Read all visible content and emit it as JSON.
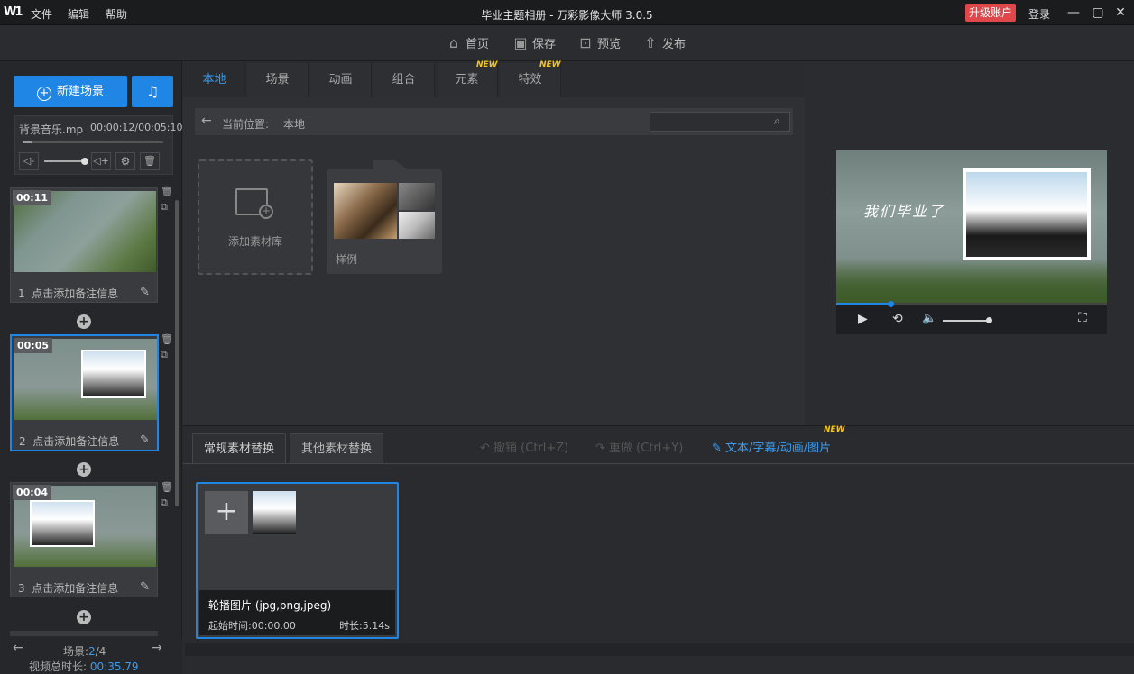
{
  "app": {
    "title": "毕业主题相册 - 万彩影像大师 3.0.5",
    "logo": "W1",
    "menu": [
      "文件",
      "编辑",
      "帮助"
    ],
    "upgrade": "升级账户",
    "login": "登录"
  },
  "toolbar": {
    "home": "首页",
    "save": "保存",
    "preview": "预览",
    "publish": "发布"
  },
  "left": {
    "new_scene": "新建场景",
    "music": {
      "name": "背景音乐.mp",
      "time": "00:00:12/00:05:10"
    },
    "scenes": [
      {
        "index": "1",
        "duration": "00:11",
        "note": "点击添加备注信息"
      },
      {
        "index": "2",
        "duration": "00:05",
        "note": "点击添加备注信息"
      },
      {
        "index": "3",
        "duration": "00:04",
        "note": "点击添加备注信息"
      }
    ],
    "footer": {
      "scene_label": "场景:",
      "scene_current": "2",
      "scene_total": "/4",
      "total_label": "视频总时长:",
      "total_value": "00:35.79"
    }
  },
  "center": {
    "tabs": [
      "本地",
      "场景",
      "动画",
      "组合",
      "元素",
      "特效"
    ],
    "new_tag": "NEW",
    "location_label": "当前位置:",
    "location_value": "本地",
    "add_library": "添加素材库",
    "sample": "样例"
  },
  "preview": {
    "caption": "我们毕业了",
    "progress": 0.2
  },
  "bottom": {
    "tabs": [
      "常规素材替换",
      "其他素材替换"
    ],
    "undo": "撤销 (Ctrl+Z)",
    "redo": "重做 (Ctrl+Y)",
    "text_tool": "文本/字幕/动画/图片",
    "new_tag": "NEW",
    "card": {
      "title": "轮播图片 (jpg,png,jpeg)",
      "start": "起始时间:00:00.00",
      "duration": "时长:5.14s"
    }
  },
  "colors": {
    "accent": "#1f86e6",
    "upgrade": "#e0474b",
    "new_tag": "#f5c518"
  }
}
